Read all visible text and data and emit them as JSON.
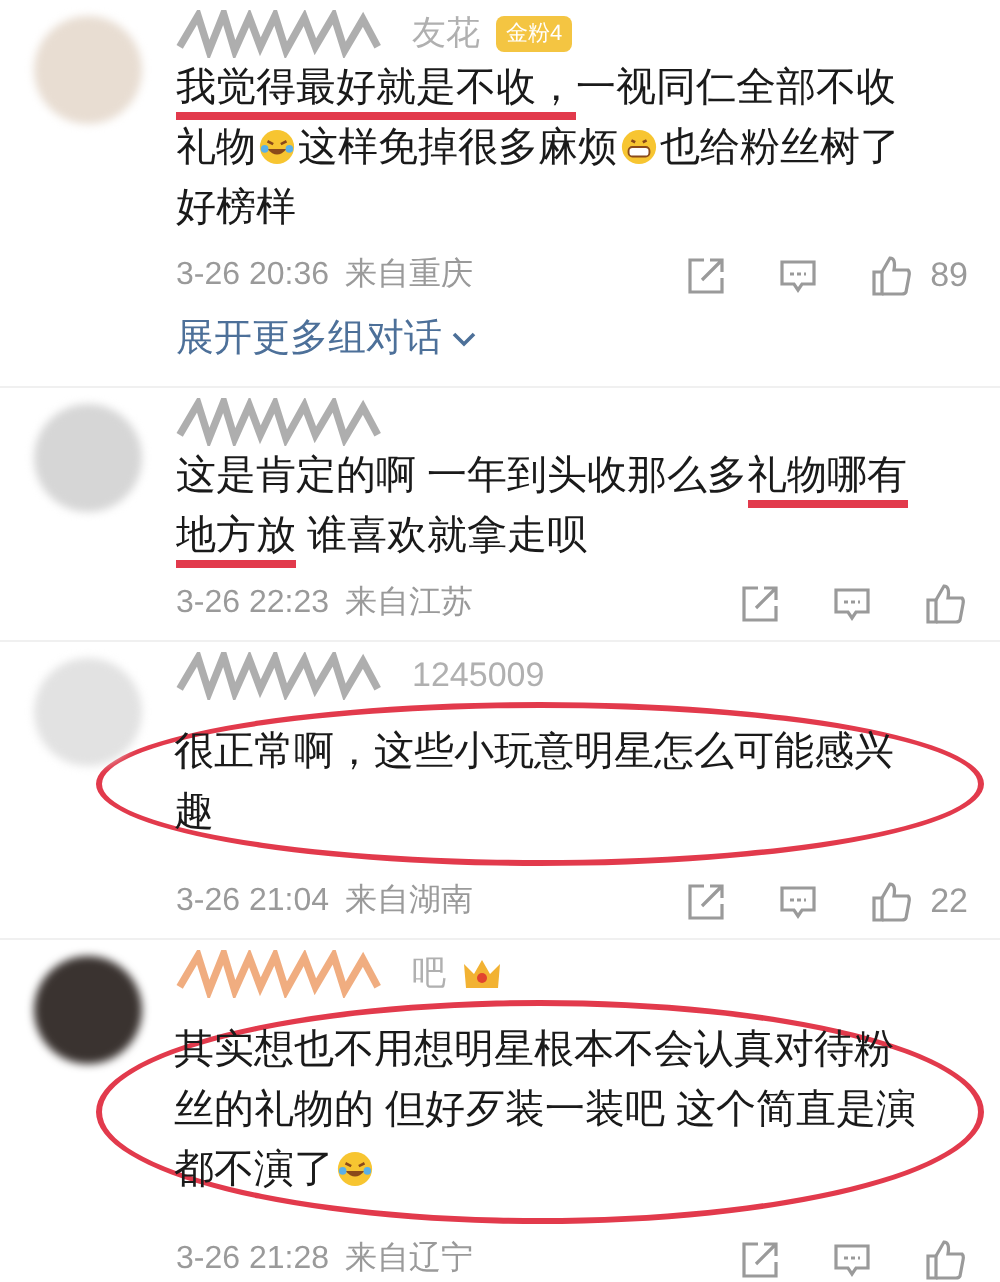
{
  "comments": [
    {
      "avatar": {
        "color": "#e8ddd2"
      },
      "name": "友花",
      "badge": "金粉4",
      "crown": false,
      "circled": false,
      "lines": [
        [
          {
            "kind": "text",
            "text": "我觉得最好就是不收，",
            "marked": true
          },
          {
            "kind": "text",
            "text": "一视同仁全部不收",
            "marked": false
          }
        ],
        [
          {
            "kind": "text",
            "text": "礼物",
            "marked": false
          },
          {
            "kind": "laugh-emoji"
          },
          {
            "kind": "text",
            "text": "这样免掉很多麻烦",
            "marked": false
          },
          {
            "kind": "grin-emoji"
          },
          {
            "kind": "text",
            "text": "也给粉丝树了",
            "marked": false
          }
        ],
        [
          {
            "kind": "text",
            "text": "好榜样",
            "marked": false
          }
        ]
      ],
      "date": "3-26 20:36",
      "location": "来自重庆",
      "likes": "89",
      "expand": "展开更多组对话"
    },
    {
      "avatar": {
        "color": "#d6d6d6"
      },
      "crown": false,
      "circled": false,
      "lines": [
        [
          {
            "kind": "text",
            "text": "这是肯定的啊 一年到头收那么多",
            "marked": false
          },
          {
            "kind": "text",
            "text": "礼物哪有",
            "marked": true
          }
        ],
        [
          {
            "kind": "text",
            "text": "地方放",
            "marked": true
          },
          {
            "kind": "text",
            "text": " 谁喜欢就拿走呗",
            "marked": false
          }
        ]
      ],
      "date": "3-26 22:23",
      "location": "来自江苏"
    },
    {
      "avatar": {
        "color": "#e2e2e2"
      },
      "name": "1245009",
      "crown": false,
      "circled": true,
      "lines": [
        [
          {
            "kind": "text",
            "text": "很正常啊，这些小玩意明星怎么可能感兴",
            "marked": false
          }
        ],
        [
          {
            "kind": "text",
            "text": "趣",
            "marked": false
          }
        ]
      ],
      "date": "3-26 21:04",
      "location": "来自湖南",
      "likes": "22"
    },
    {
      "avatar": {
        "color": "#3a3330"
      },
      "name": "吧",
      "crown": true,
      "circled": true,
      "lines": [
        [
          {
            "kind": "text",
            "text": "其实想也不用想明星根本不会认真对待粉",
            "marked": false
          }
        ],
        [
          {
            "kind": "text",
            "text": "丝的礼物的 但好歹装一装吧 这个简直是演",
            "marked": false
          }
        ],
        [
          {
            "kind": "text",
            "text": "都不演了",
            "marked": false
          },
          {
            "kind": "laugh-emoji"
          }
        ]
      ],
      "date": "3-26 21:28",
      "location": "来自辽宁"
    }
  ]
}
